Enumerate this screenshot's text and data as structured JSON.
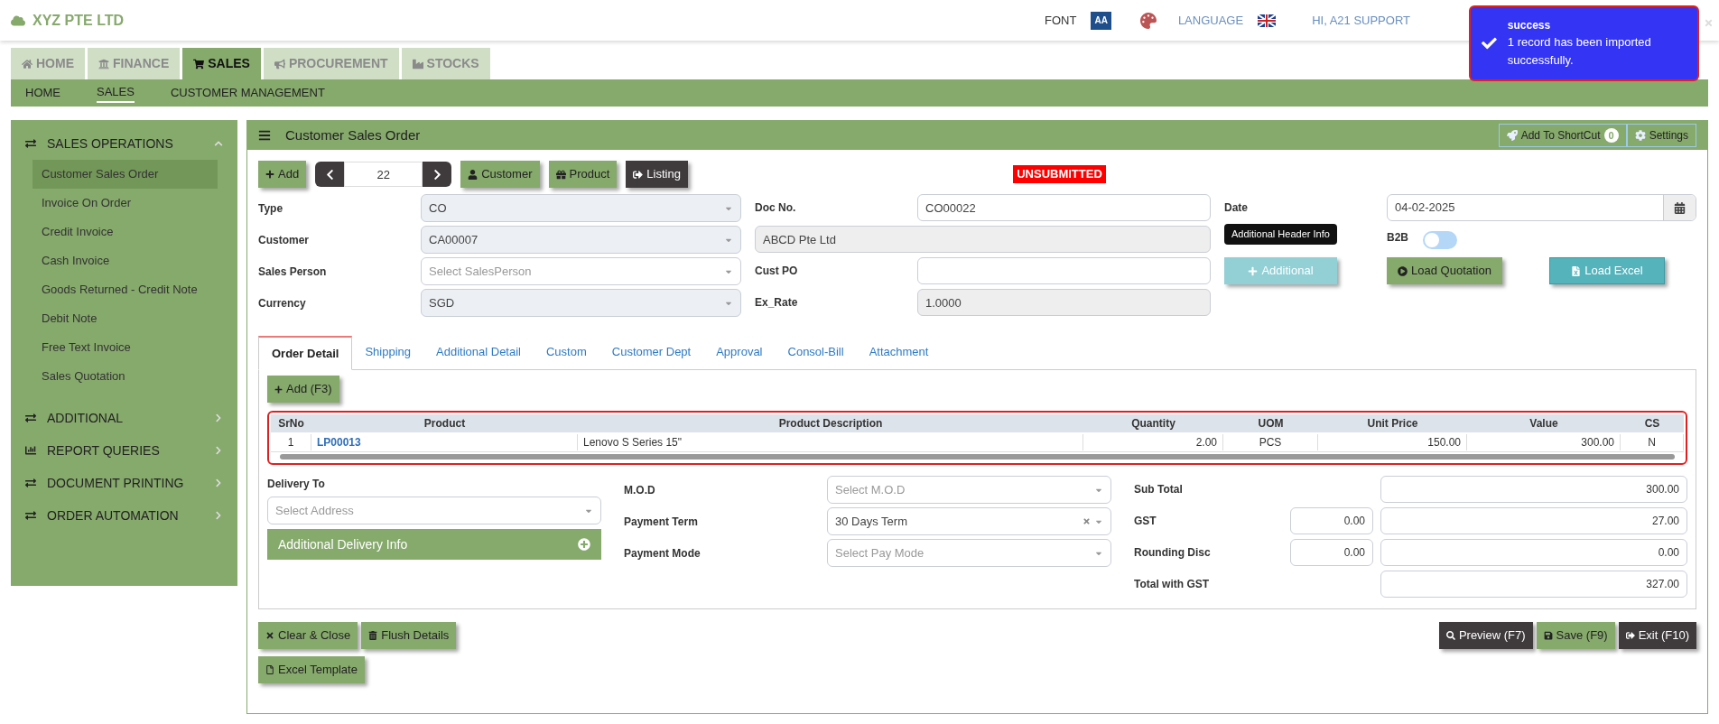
{
  "brand": "XYZ PTE LTD",
  "header": {
    "font_label": "FONT",
    "font_icon_text": "AA",
    "language_label": "LANGUAGE",
    "user": "HI, A21 SUPPORT"
  },
  "toast": {
    "title": "success",
    "message": "1 record has been imported successfully."
  },
  "main_tabs": [
    {
      "label": "HOME",
      "selected": false
    },
    {
      "label": "FINANCE",
      "selected": false
    },
    {
      "label": "SALES",
      "selected": true
    },
    {
      "label": "PROCUREMENT",
      "selected": false
    },
    {
      "label": "STOCKS",
      "selected": false
    }
  ],
  "sub_nav": [
    {
      "label": "HOME",
      "selected": false
    },
    {
      "label": "SALES",
      "selected": true
    },
    {
      "label": "CUSTOMER MANAGEMENT",
      "selected": false
    }
  ],
  "sidebar": [
    {
      "label": "SALES OPERATIONS",
      "expanded": true,
      "children": [
        {
          "label": "Customer Sales Order",
          "selected": true
        },
        {
          "label": "Invoice On Order",
          "selected": false
        },
        {
          "label": "Credit Invoice",
          "selected": false
        },
        {
          "label": "Cash Invoice",
          "selected": false
        },
        {
          "label": "Goods Returned - Credit Note",
          "selected": false
        },
        {
          "label": "Debit Note",
          "selected": false
        },
        {
          "label": "Free Text Invoice",
          "selected": false
        },
        {
          "label": "Sales Quotation",
          "selected": false
        }
      ]
    },
    {
      "label": "ADDITIONAL",
      "expanded": false
    },
    {
      "label": "REPORT QUERIES",
      "expanded": false
    },
    {
      "label": "DOCUMENT PRINTING",
      "expanded": false
    },
    {
      "label": "ORDER AUTOMATION",
      "expanded": false
    }
  ],
  "panel": {
    "title": "Customer Sales Order",
    "shortcut_label": "Add To ShortCut",
    "shortcut_count": "0",
    "settings_label": "Settings"
  },
  "toolbar": {
    "add": "Add",
    "record_number": "22",
    "buttons": [
      {
        "label": "Customer",
        "kind": "green"
      },
      {
        "label": "Product",
        "kind": "green"
      },
      {
        "label": "Listing",
        "kind": "dark"
      }
    ]
  },
  "status_badge": "UNSUBMITTED",
  "left_fields": [
    {
      "label": "Type",
      "value": "CO"
    },
    {
      "label": "Customer",
      "value": "CA00007"
    },
    {
      "label": "Sales Person",
      "placeholder": "Select SalesPerson"
    },
    {
      "label": "Currency",
      "value": "SGD"
    }
  ],
  "mid_fields": [
    {
      "label": "Doc No.",
      "value": "CO00022",
      "disabled": false
    },
    {
      "value": "ABCD Pte Ltd",
      "disabled": true
    },
    {
      "label": "Cust PO",
      "disabled": false
    },
    {
      "label": "Ex_Rate",
      "value": "1.0000",
      "disabled": true
    }
  ],
  "date": {
    "label": "Date",
    "value": "04-02-2025"
  },
  "b2b": {
    "label": "B2B",
    "on": false
  },
  "tooltip": "Additional Header Info",
  "header_buttons": [
    {
      "label": "Additional",
      "kind": "light-teal"
    },
    {
      "label": "Load Quotation",
      "kind": "green"
    },
    {
      "label": "Load Excel",
      "kind": "teal"
    }
  ],
  "detail_tabs": [
    {
      "label": "Order Detail",
      "selected": true
    },
    {
      "label": "Shipping",
      "selected": false
    },
    {
      "label": "Additional Detail",
      "selected": false
    },
    {
      "label": "Custom",
      "selected": false
    },
    {
      "label": "Customer Dept",
      "selected": false
    },
    {
      "label": "Approval",
      "selected": false
    },
    {
      "label": "Consol-Bill",
      "selected": false
    },
    {
      "label": "Attachment",
      "selected": false
    }
  ],
  "add_line": "Add (F3)",
  "table": {
    "columns": [
      {
        "label": "SrNo",
        "kind": "center"
      },
      {
        "label": "Product",
        "kind": "link"
      },
      {
        "label": "Product Description",
        "kind": "text"
      },
      {
        "label": "Quantity",
        "kind": "number"
      },
      {
        "label": "UOM",
        "kind": "center"
      },
      {
        "label": "Unit Price",
        "kind": "number"
      },
      {
        "label": "Value",
        "kind": "number"
      },
      {
        "label": "CS",
        "kind": "center"
      }
    ],
    "rows": [
      [
        "1",
        "LP00013",
        "Lenovo S Series 15\"",
        "2.00",
        "PCS",
        "150.00",
        "300.00",
        "N"
      ]
    ]
  },
  "delivery": {
    "label": "Delivery To",
    "placeholder": "Select Address",
    "info_button": "Additional Delivery Info"
  },
  "mid_selects": [
    {
      "label": "M.O.D",
      "placeholder": "Select M.O.D",
      "clearable": false
    },
    {
      "label": "Payment Term",
      "value": "30 Days Term",
      "clearable": true
    },
    {
      "label": "Payment Mode",
      "placeholder": "Select Pay Mode",
      "clearable": false
    }
  ],
  "totals": [
    {
      "label": "Sub Total",
      "value": "300.00"
    },
    {
      "label": "GST",
      "rate": "0.00",
      "value": "27.00"
    },
    {
      "label": "Rounding Disc",
      "rate": "0.00",
      "value": "0.00"
    },
    {
      "label": "Total with GST",
      "value": "327.00"
    }
  ],
  "footer_left": [
    {
      "label": "Clear & Close"
    },
    {
      "label": "Flush Details"
    }
  ],
  "excel_template": "Excel Template",
  "footer_right": [
    {
      "label": "Preview (F7)",
      "kind": "dark"
    },
    {
      "label": "Save (F9)",
      "kind": "green"
    },
    {
      "label": "Exit (F10)",
      "kind": "dark"
    }
  ]
}
